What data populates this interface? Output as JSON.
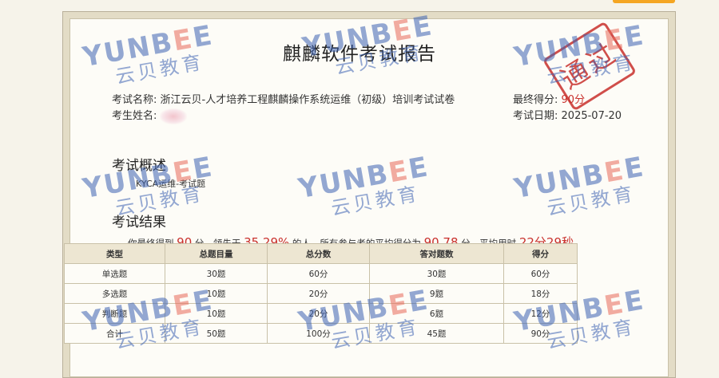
{
  "report": {
    "title": "麒麟软件考试报告",
    "exam_name_label": "考试名称:",
    "exam_name": "浙江云贝-人才培养工程麒麟操作系统运维（初级）培训考试试卷",
    "student_name_label": "考生姓名:",
    "final_score_label": "最终得分:",
    "final_score": "90分",
    "exam_date_label": "考试日期:",
    "exam_date": "2025-07-20",
    "stamp_text": "通过"
  },
  "overview": {
    "heading": "考试概述",
    "text": "KYCA运维-考试题"
  },
  "results": {
    "heading": "考试结果",
    "summary_prefix": "你最终得到",
    "score": "90",
    "score_unit": "分，领先于",
    "percent": "35.29%",
    "percent_suffix": "的人，所有参与者的平均得分为",
    "avg": "90.78",
    "avg_suffix": "分，平均用时",
    "avg_time": "22分29秒",
    "table": {
      "headers": [
        "类型",
        "总题目量",
        "总分数",
        "答对题数",
        "得分"
      ],
      "rows": [
        [
          "单选题",
          "30题",
          "60分",
          "30题",
          "60分"
        ],
        [
          "多选题",
          "10题",
          "20分",
          "9题",
          "18分"
        ],
        [
          "判断题",
          "10题",
          "20分",
          "6题",
          "12分"
        ],
        [
          "合计",
          "50题",
          "100分",
          "45题",
          "90分"
        ]
      ]
    }
  },
  "watermark": {
    "en": "YUNBEE",
    "cn": "云贝教育"
  },
  "colors": {
    "accent_red": "#c9302c",
    "watermark_blue": "#3d63b3",
    "header_bg": "#ede6d2"
  }
}
